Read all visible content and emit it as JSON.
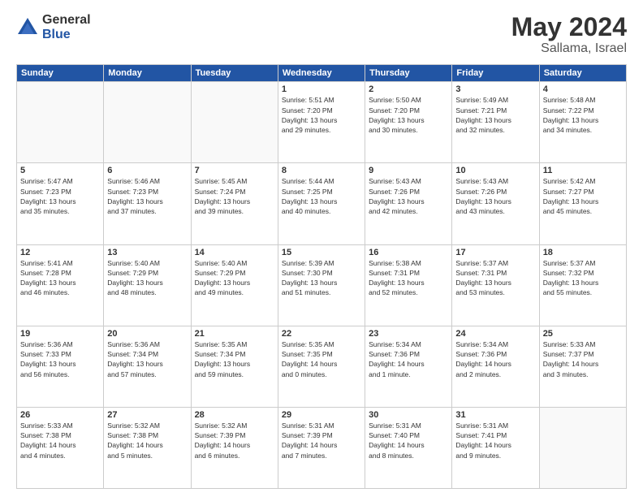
{
  "header": {
    "logo_general": "General",
    "logo_blue": "Blue",
    "month": "May 2024",
    "location": "Sallama, Israel"
  },
  "days_of_week": [
    "Sunday",
    "Monday",
    "Tuesday",
    "Wednesday",
    "Thursday",
    "Friday",
    "Saturday"
  ],
  "weeks": [
    [
      {
        "day": "",
        "info": ""
      },
      {
        "day": "",
        "info": ""
      },
      {
        "day": "",
        "info": ""
      },
      {
        "day": "1",
        "info": "Sunrise: 5:51 AM\nSunset: 7:20 PM\nDaylight: 13 hours\nand 29 minutes."
      },
      {
        "day": "2",
        "info": "Sunrise: 5:50 AM\nSunset: 7:20 PM\nDaylight: 13 hours\nand 30 minutes."
      },
      {
        "day": "3",
        "info": "Sunrise: 5:49 AM\nSunset: 7:21 PM\nDaylight: 13 hours\nand 32 minutes."
      },
      {
        "day": "4",
        "info": "Sunrise: 5:48 AM\nSunset: 7:22 PM\nDaylight: 13 hours\nand 34 minutes."
      }
    ],
    [
      {
        "day": "5",
        "info": "Sunrise: 5:47 AM\nSunset: 7:23 PM\nDaylight: 13 hours\nand 35 minutes."
      },
      {
        "day": "6",
        "info": "Sunrise: 5:46 AM\nSunset: 7:23 PM\nDaylight: 13 hours\nand 37 minutes."
      },
      {
        "day": "7",
        "info": "Sunrise: 5:45 AM\nSunset: 7:24 PM\nDaylight: 13 hours\nand 39 minutes."
      },
      {
        "day": "8",
        "info": "Sunrise: 5:44 AM\nSunset: 7:25 PM\nDaylight: 13 hours\nand 40 minutes."
      },
      {
        "day": "9",
        "info": "Sunrise: 5:43 AM\nSunset: 7:26 PM\nDaylight: 13 hours\nand 42 minutes."
      },
      {
        "day": "10",
        "info": "Sunrise: 5:43 AM\nSunset: 7:26 PM\nDaylight: 13 hours\nand 43 minutes."
      },
      {
        "day": "11",
        "info": "Sunrise: 5:42 AM\nSunset: 7:27 PM\nDaylight: 13 hours\nand 45 minutes."
      }
    ],
    [
      {
        "day": "12",
        "info": "Sunrise: 5:41 AM\nSunset: 7:28 PM\nDaylight: 13 hours\nand 46 minutes."
      },
      {
        "day": "13",
        "info": "Sunrise: 5:40 AM\nSunset: 7:29 PM\nDaylight: 13 hours\nand 48 minutes."
      },
      {
        "day": "14",
        "info": "Sunrise: 5:40 AM\nSunset: 7:29 PM\nDaylight: 13 hours\nand 49 minutes."
      },
      {
        "day": "15",
        "info": "Sunrise: 5:39 AM\nSunset: 7:30 PM\nDaylight: 13 hours\nand 51 minutes."
      },
      {
        "day": "16",
        "info": "Sunrise: 5:38 AM\nSunset: 7:31 PM\nDaylight: 13 hours\nand 52 minutes."
      },
      {
        "day": "17",
        "info": "Sunrise: 5:37 AM\nSunset: 7:31 PM\nDaylight: 13 hours\nand 53 minutes."
      },
      {
        "day": "18",
        "info": "Sunrise: 5:37 AM\nSunset: 7:32 PM\nDaylight: 13 hours\nand 55 minutes."
      }
    ],
    [
      {
        "day": "19",
        "info": "Sunrise: 5:36 AM\nSunset: 7:33 PM\nDaylight: 13 hours\nand 56 minutes."
      },
      {
        "day": "20",
        "info": "Sunrise: 5:36 AM\nSunset: 7:34 PM\nDaylight: 13 hours\nand 57 minutes."
      },
      {
        "day": "21",
        "info": "Sunrise: 5:35 AM\nSunset: 7:34 PM\nDaylight: 13 hours\nand 59 minutes."
      },
      {
        "day": "22",
        "info": "Sunrise: 5:35 AM\nSunset: 7:35 PM\nDaylight: 14 hours\nand 0 minutes."
      },
      {
        "day": "23",
        "info": "Sunrise: 5:34 AM\nSunset: 7:36 PM\nDaylight: 14 hours\nand 1 minute."
      },
      {
        "day": "24",
        "info": "Sunrise: 5:34 AM\nSunset: 7:36 PM\nDaylight: 14 hours\nand 2 minutes."
      },
      {
        "day": "25",
        "info": "Sunrise: 5:33 AM\nSunset: 7:37 PM\nDaylight: 14 hours\nand 3 minutes."
      }
    ],
    [
      {
        "day": "26",
        "info": "Sunrise: 5:33 AM\nSunset: 7:38 PM\nDaylight: 14 hours\nand 4 minutes."
      },
      {
        "day": "27",
        "info": "Sunrise: 5:32 AM\nSunset: 7:38 PM\nDaylight: 14 hours\nand 5 minutes."
      },
      {
        "day": "28",
        "info": "Sunrise: 5:32 AM\nSunset: 7:39 PM\nDaylight: 14 hours\nand 6 minutes."
      },
      {
        "day": "29",
        "info": "Sunrise: 5:31 AM\nSunset: 7:39 PM\nDaylight: 14 hours\nand 7 minutes."
      },
      {
        "day": "30",
        "info": "Sunrise: 5:31 AM\nSunset: 7:40 PM\nDaylight: 14 hours\nand 8 minutes."
      },
      {
        "day": "31",
        "info": "Sunrise: 5:31 AM\nSunset: 7:41 PM\nDaylight: 14 hours\nand 9 minutes."
      },
      {
        "day": "",
        "info": ""
      }
    ]
  ]
}
